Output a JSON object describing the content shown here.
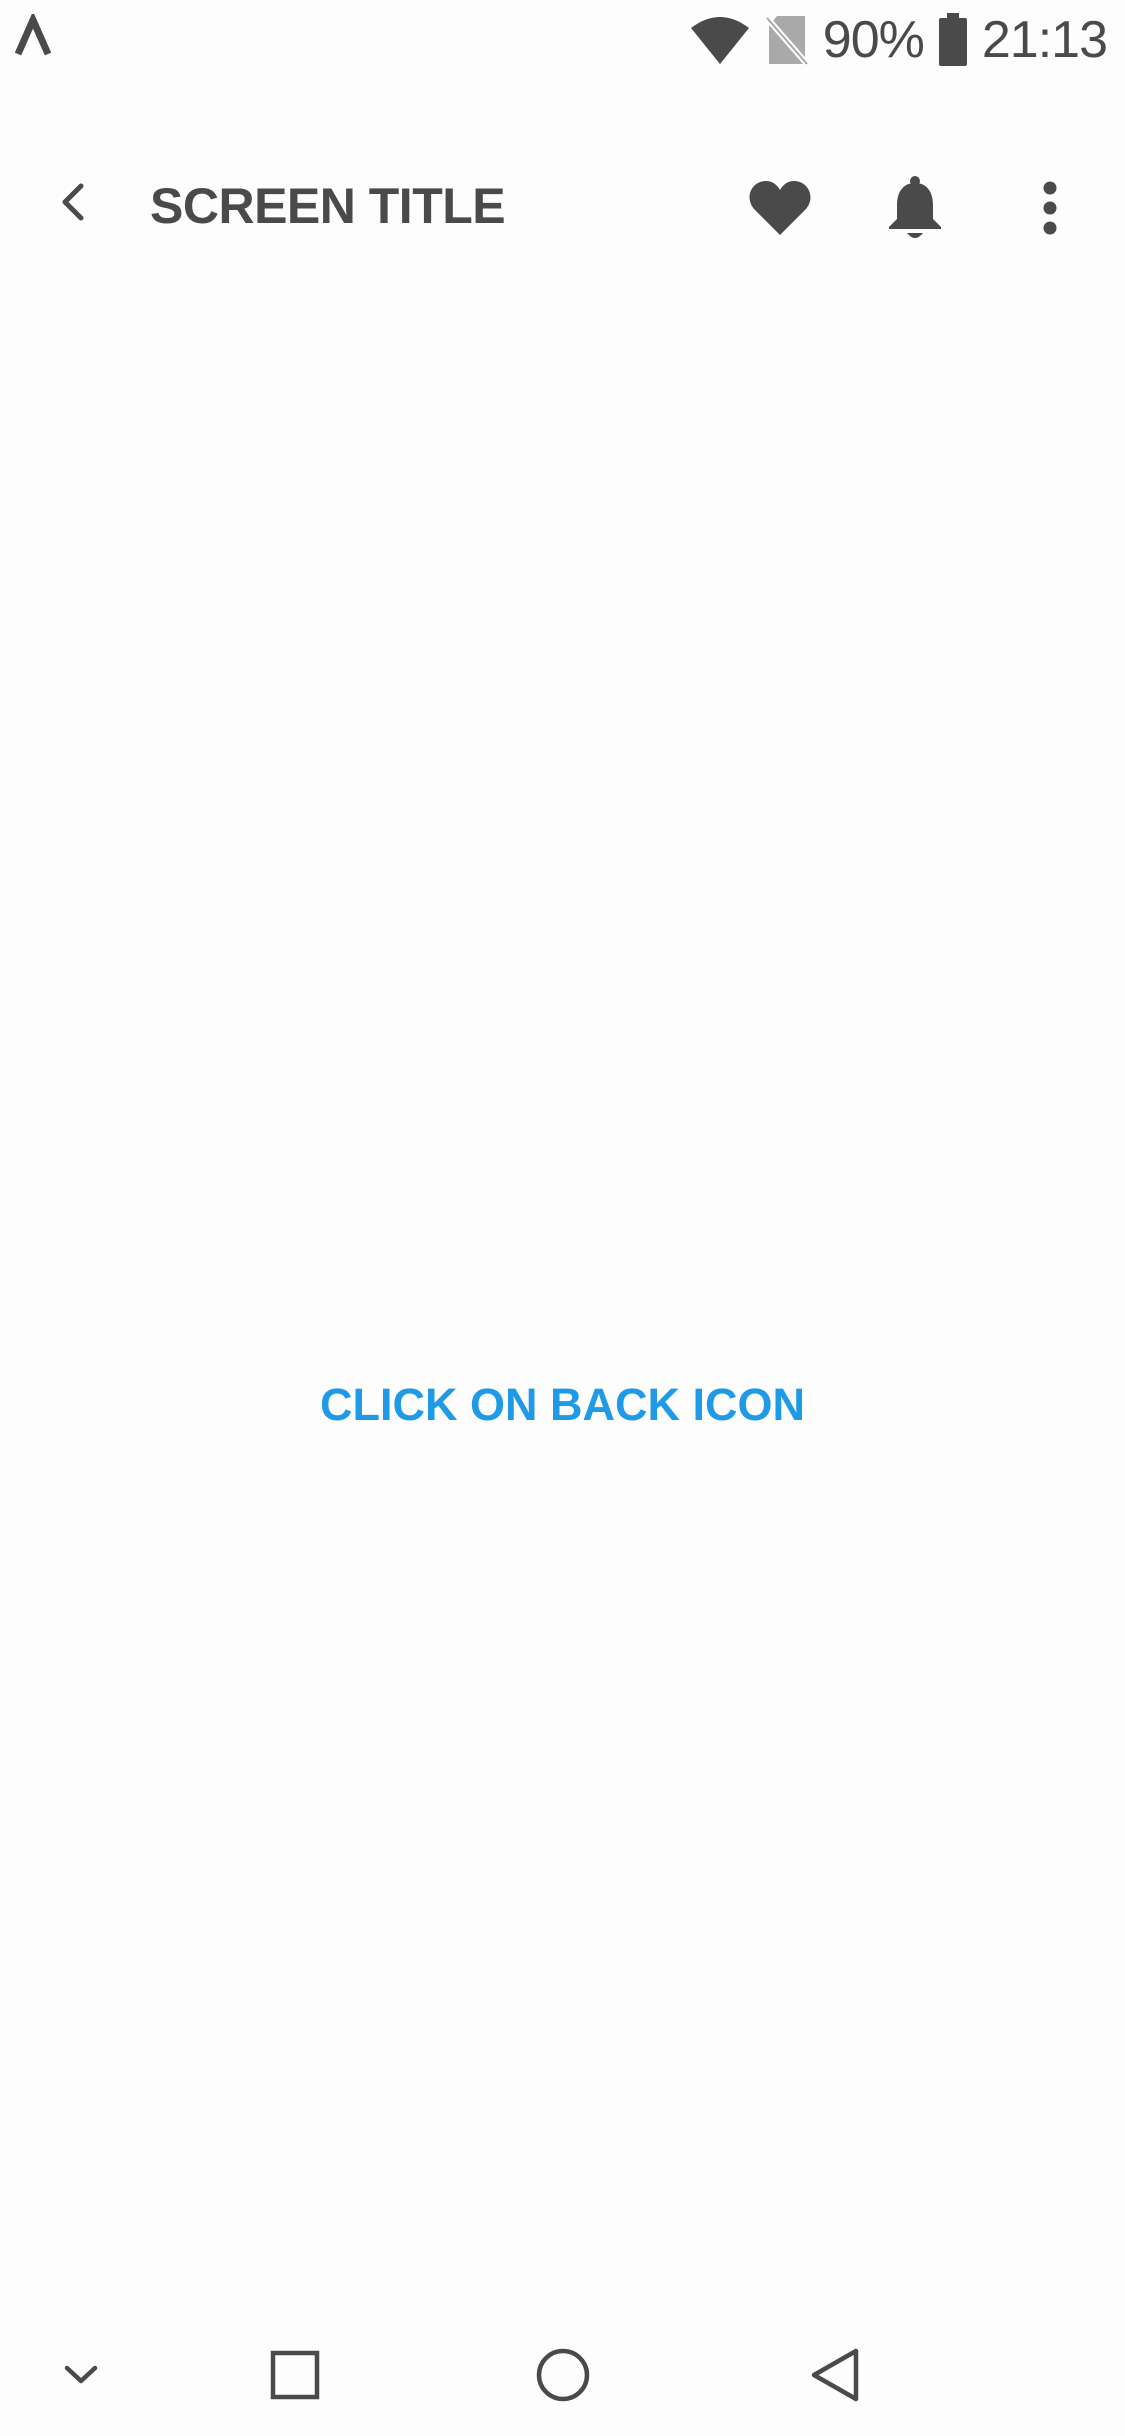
{
  "status_bar": {
    "left_icon": "arrow-notification-icon",
    "battery_percent": "90%",
    "time": "21:13",
    "icons": [
      "wifi-icon",
      "no-sim-icon",
      "battery-icon"
    ]
  },
  "app_bar": {
    "back_icon": "chevron-left-icon",
    "title": "SCREEN TITLE",
    "actions": [
      "heart-icon",
      "bell-icon",
      "more-vertical-icon"
    ]
  },
  "main": {
    "link_text": "CLICK ON BACK ICON",
    "link_color": "#1e9ae6"
  },
  "nav_bar": {
    "buttons": [
      "hide-chevron-icon",
      "recents-square-icon",
      "home-circle-icon",
      "back-triangle-icon"
    ]
  },
  "colors": {
    "background": "#fdfdfd",
    "icon": "#4a4a4a",
    "accent": "#1e9ae6"
  }
}
